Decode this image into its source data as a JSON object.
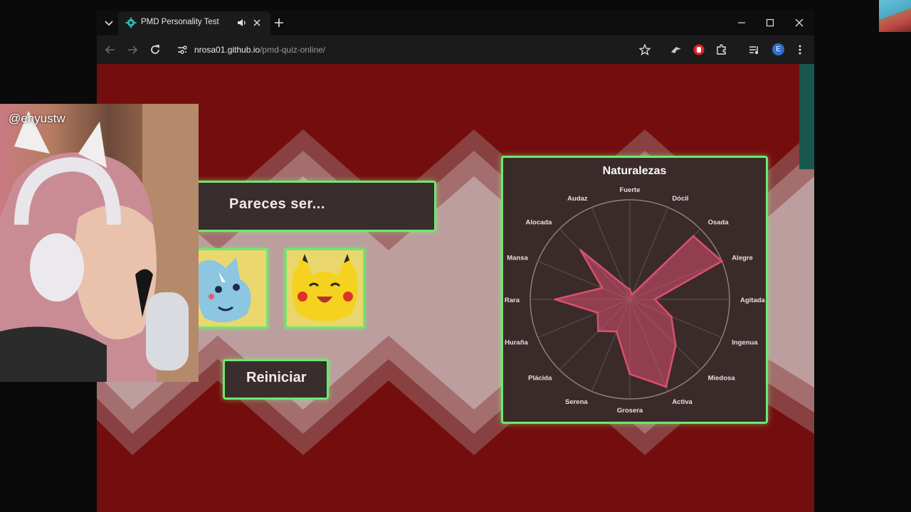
{
  "browser": {
    "tab_title": "PMD Personality Test",
    "url_host": "nrosa01.github.io",
    "url_path": "/pmd-quiz-online/",
    "profile_initial": "E",
    "accent_color": "#2f6fd0"
  },
  "page": {
    "result_label": "Pareces ser...",
    "reset_label": "Reiniciar",
    "panel_border_color": "#6ee86e",
    "background_color": "#740e0e"
  },
  "stream": {
    "handle": "@enyustw"
  },
  "chart_data": {
    "type": "radar",
    "title": "Naturalezas",
    "categories": [
      "Fuerte",
      "Dócil",
      "Osada",
      "Alegre",
      "Agitada",
      "Ingenua",
      "Miedosa",
      "Activa",
      "Grosera",
      "Serena",
      "Plácida",
      "Huraña",
      "Rara",
      "Mansa",
      "Alocada",
      "Audaz"
    ],
    "values": [
      0.1,
      0.05,
      0.9,
      1.0,
      0.25,
      0.45,
      0.65,
      0.95,
      0.75,
      0.35,
      0.45,
      0.35,
      0.75,
      0.3,
      0.7,
      0.15
    ],
    "rmax": 1.0,
    "series_color": "#d9506f",
    "grid": true
  }
}
